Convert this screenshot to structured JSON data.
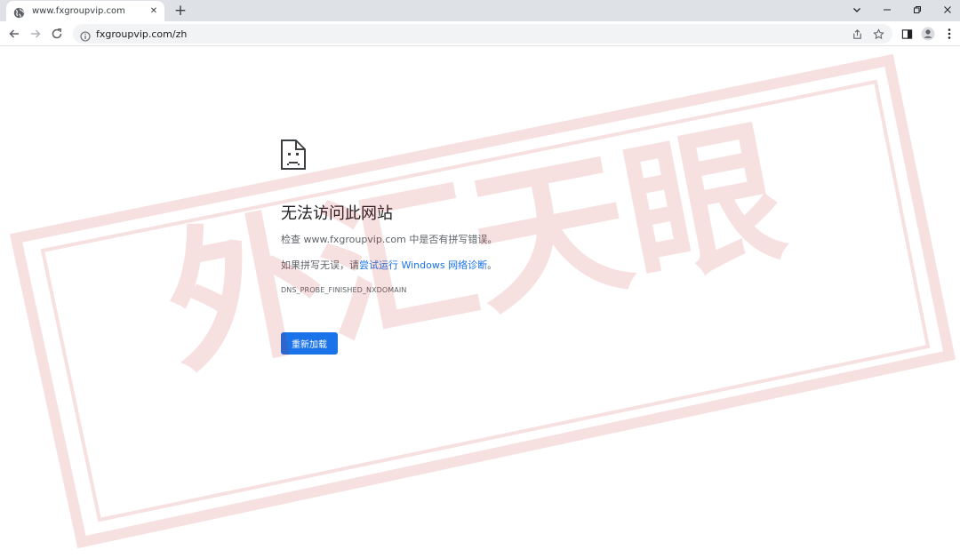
{
  "browser": {
    "tab_title": "www.fxgroupvip.com",
    "tab_close": "✕",
    "new_tab": "+",
    "url": "fxgroupvip.com/zh"
  },
  "error_page": {
    "title": "无法访问此网站",
    "check_text": "检查 www.fxgroupvip.com 中是否有拼写错误。",
    "suggestion_prefix": "如果拼写无误，请",
    "suggestion_link": "尝试运行 Windows 网络诊断",
    "suggestion_suffix": "。",
    "error_code": "DNS_PROBE_FINISHED_NXDOMAIN",
    "reload_label": "重新加载"
  },
  "watermark": {
    "text": "外汇天眼",
    "color": "#c4161c"
  },
  "colors": {
    "accent": "#1a73e8",
    "tabstrip": "#dee1e6",
    "omnibox": "#f1f3f4"
  },
  "icons": [
    "globe-icon",
    "close-icon",
    "plus-icon",
    "chevron-down-icon",
    "minimize-icon",
    "restore-icon",
    "window-close-icon",
    "back-arrow-icon",
    "forward-arrow-icon",
    "reload-icon",
    "info-icon",
    "share-icon",
    "star-icon",
    "side-panel-icon",
    "profile-icon",
    "menu-icon",
    "sad-page-icon"
  ]
}
